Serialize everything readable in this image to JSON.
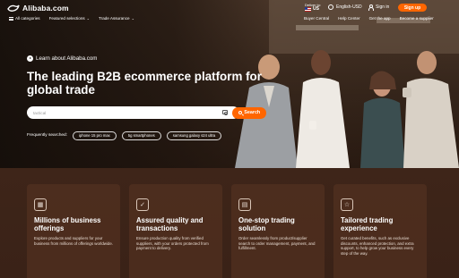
{
  "header": {
    "logo_text": "Alibaba.com",
    "deliver_to_label": "Deliver to:",
    "deliver_country": "US",
    "language_currency": "English-USD",
    "sign_in": "Sign in",
    "sign_up": "Sign up"
  },
  "nav": {
    "left": [
      {
        "label": "All categories",
        "icon": "menu-icon"
      },
      {
        "label": "Featured selections",
        "icon": "chevron-down-icon"
      },
      {
        "label": "Trade Assurance",
        "icon": "chevron-down-icon"
      }
    ],
    "right": [
      "Buyer Central",
      "Help Center",
      "Get the app",
      "Become a supplier"
    ]
  },
  "hero": {
    "learn_link": "Learn about Alibaba.com",
    "headline": "The leading B2B ecommerce platform for global trade",
    "search_placeholder": "tactical",
    "search_button": "Search",
    "frequently_label": "Frequently searched:",
    "frequent_chips": [
      "iphone 15 pro max",
      "5g smartphones",
      "samsung galaxy s24 ultra"
    ]
  },
  "features": [
    {
      "icon": "grid-icon",
      "title": "Millions of business offerings",
      "desc": "Explore products and suppliers for your business from millions of offerings worldwide."
    },
    {
      "icon": "shield-check-icon",
      "title": "Assured quality and transactions",
      "desc": "Ensure production quality from verified suppliers, with your orders protected from payment to delivery."
    },
    {
      "icon": "document-icon",
      "title": "One-stop trading solution",
      "desc": "Order seamlessly from product/supplier search to order management, payment, and fulfillment."
    },
    {
      "icon": "user-star-icon",
      "title": "Tailored trading experience",
      "desc": "Get curated benefits, such as exclusive discounts, enhanced protection, and extra support, to help grow your business every step of the way."
    }
  ],
  "colors": {
    "accent": "#ff6600",
    "features_bg": "#3e2519"
  }
}
